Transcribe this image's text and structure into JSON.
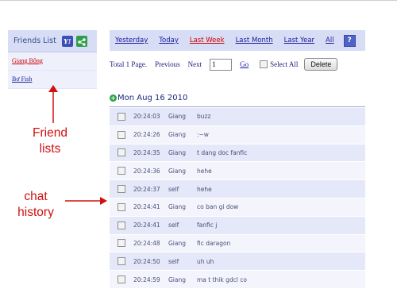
{
  "sidebar": {
    "title": "Friends List",
    "friends": [
      {
        "label": "Giang Bông",
        "color": "#cc0000"
      },
      {
        "label": "Bơ Fish",
        "color": "#1a1a9a"
      }
    ]
  },
  "annotations": {
    "friend_lists": "Friend lists",
    "chat_history": "chat history",
    "color": "#d11010"
  },
  "filter": {
    "links": [
      "Yesterday",
      "Today",
      "Last Week",
      "Last Month",
      "Last Year",
      "All"
    ],
    "active": "Last Week",
    "help_label": "?"
  },
  "pager": {
    "summary": "Total 1 Page.",
    "previous": "Previous",
    "next": "Next",
    "page_value": "1",
    "go": "Go",
    "select_all": "Select All",
    "delete": "Delete"
  },
  "date_group": "Mon Aug 16 2010",
  "messages": [
    {
      "time": "20:24:03",
      "from": "Giang",
      "text": "buzz"
    },
    {
      "time": "20:24:26",
      "from": "Giang",
      "text": ":~w"
    },
    {
      "time": "20:24:35",
      "from": "Giang",
      "text": "t dang doc fanfic"
    },
    {
      "time": "20:24:36",
      "from": "Giang",
      "text": "hehe"
    },
    {
      "time": "20:24:37",
      "from": "self",
      "text": "hehe"
    },
    {
      "time": "20:24:41",
      "from": "Giang",
      "text": "co ban gi dow"
    },
    {
      "time": "20:24:41",
      "from": "self",
      "text": "fanfic j"
    },
    {
      "time": "20:24:48",
      "from": "Giang",
      "text": "fic daragon"
    },
    {
      "time": "20:24:50",
      "from": "self",
      "text": "uh uh"
    },
    {
      "time": "20:24:59",
      "from": "Giang",
      "text": "ma t thik gdcl co"
    }
  ]
}
